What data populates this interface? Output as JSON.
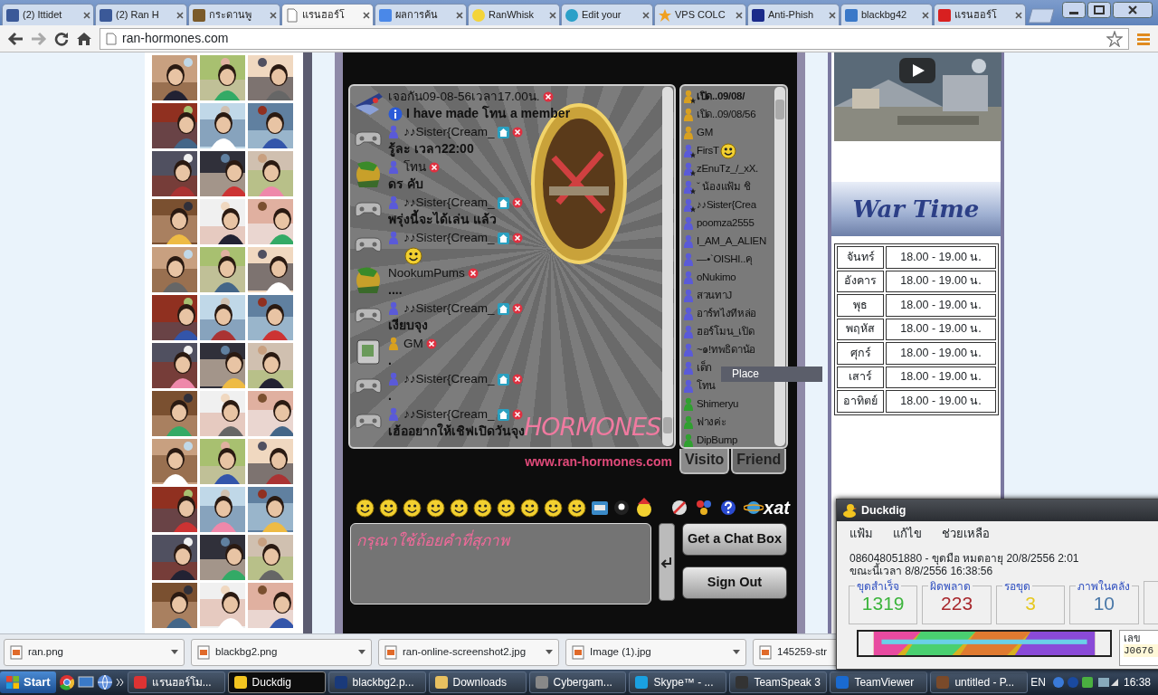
{
  "browser": {
    "tabs": [
      {
        "label": "(2) Ittidet",
        "selected": false
      },
      {
        "label": "(2) Ran H",
        "selected": false
      },
      {
        "label": "กระดานพู",
        "selected": false
      },
      {
        "label": "แรนฮอร์โ",
        "selected": true
      },
      {
        "label": "ผลการค้น",
        "selected": false
      },
      {
        "label": "RanWhisk",
        "selected": false
      },
      {
        "label": "Edit your",
        "selected": false
      },
      {
        "label": "VPS COLC",
        "selected": false
      },
      {
        "label": "Anti-Phish",
        "selected": false
      },
      {
        "label": "blackbg42",
        "selected": false
      },
      {
        "label": "แรนฮอร์โ",
        "selected": false
      }
    ],
    "address": "ran-hormones.com"
  },
  "chat": {
    "messages": [
      {
        "name": "เจอกัน09-08-56เวลา17.00น.",
        "home": false,
        "info": true,
        "kind": "text",
        "text": "I have made โทน a member"
      },
      {
        "color": "#5a5ad8",
        "name": "♪♪Sister{Cream_",
        "home": true,
        "info": false,
        "kind": "text",
        "text": "รู้ละ เวลา22:00"
      },
      {
        "color": "#5a5ad8",
        "name": "โทน",
        "home": false,
        "info": false,
        "kind": "text",
        "text": "ดร คับ"
      },
      {
        "color": "#5a5ad8",
        "name": "♪♪Sister{Cream_",
        "home": true,
        "info": false,
        "kind": "text",
        "text": "พรุ่งนี้จะได้เล่น แล้ว"
      },
      {
        "color": "#5a5ad8",
        "name": "♪♪Sister{Cream_",
        "home": true,
        "info": false,
        "kind": "emoji"
      },
      {
        "name": "NookumPums",
        "home": false,
        "info": false,
        "kind": "text",
        "text": "...."
      },
      {
        "color": "#5a5ad8",
        "name": "♪♪Sister{Cream_",
        "home": true,
        "info": false,
        "kind": "text",
        "text": "เงียบจุง"
      },
      {
        "color": "#d8a020",
        "name": "GM",
        "home": false,
        "info": false,
        "kind": "text",
        "text": "."
      },
      {
        "color": "#5a5ad8",
        "name": "♪♪Sister{Cream_",
        "home": true,
        "info": false,
        "kind": "text",
        "text": "."
      },
      {
        "color": "#5a5ad8",
        "name": "♪♪Sister{Cream_",
        "home": true,
        "info": false,
        "kind": "text",
        "text": "เฮ้ออยากให้เชิฟเปิดวันจุง"
      }
    ],
    "brand": "HORMONES",
    "site_url": "www.ran-hormones.com",
    "users": [
      {
        "name": "เปิด..09/08/",
        "color": "#d8a020",
        "star": true,
        "bold": true,
        "emoji": false
      },
      {
        "name": "เปิด..09/08/56",
        "color": "#d8a020",
        "star": false,
        "bold": false,
        "emoji": false
      },
      {
        "name": "GM",
        "color": "#d8a020",
        "star": false,
        "bold": false,
        "emoji": false
      },
      {
        "name": "FirsT",
        "color": "#5a5ad8",
        "star": true,
        "bold": false,
        "emoji": true
      },
      {
        "name": "zEnuTz_/_xX.",
        "color": "#5a5ad8",
        "star": true,
        "bold": false,
        "emoji": false
      },
      {
        "name": "ˇ น้องแฟ้ม ชิ",
        "color": "#5a5ad8",
        "star": true,
        "bold": false,
        "emoji": false
      },
      {
        "name": "♪♪Sister{Crea",
        "color": "#5a5ad8",
        "star": true,
        "bold": false,
        "emoji": false
      },
      {
        "name": "poomza2555",
        "color": "#5a5ad8",
        "star": false,
        "bold": false,
        "emoji": false
      },
      {
        "name": "I_AM_A_ALIEN",
        "color": "#5a5ad8",
        "star": false,
        "bold": false,
        "emoji": false
      },
      {
        "name": "—•`OISHI..คุ",
        "color": "#5a5ad8",
        "star": false,
        "bold": false,
        "emoji": false
      },
      {
        "name": "oNukimo",
        "color": "#5a5ad8",
        "star": false,
        "bold": false,
        "emoji": false
      },
      {
        "name": "สวนทาJ",
        "color": "#5a5ad8",
        "star": false,
        "bold": false,
        "emoji": false
      },
      {
        "name": "อาร์ทไงทีหล่อ",
        "color": "#5a5ad8",
        "star": false,
        "bold": false,
        "emoji": false
      },
      {
        "name": "ฮอร์โมน_เปิด",
        "color": "#5a5ad8",
        "star": false,
        "bold": false,
        "emoji": false
      },
      {
        "name": "~๑!ทพธิดาน้อ",
        "color": "#5a5ad8",
        "star": false,
        "bold": false,
        "emoji": false
      },
      {
        "name": "เด็ก",
        "color": "#5a5ad8",
        "star": false,
        "bold": false,
        "emoji": false
      },
      {
        "name": "โทน",
        "color": "#5a5ad8",
        "star": false,
        "bold": false,
        "emoji": false
      },
      {
        "name": "Shimeryu",
        "color": "#30a030",
        "star": false,
        "bold": false,
        "emoji": false
      },
      {
        "name": "ฟางค่ะ",
        "color": "#30a030",
        "star": false,
        "bold": false,
        "emoji": false
      },
      {
        "name": "DipBump",
        "color": "#30a030",
        "star": false,
        "bold": false,
        "emoji": false
      }
    ],
    "tooltip": "Place",
    "list_tabs": [
      {
        "label": "Visito",
        "selected": true
      },
      {
        "label": "Friend",
        "selected": false
      }
    ],
    "xat_logo": "xat",
    "input": {
      "placeholder": "กรุณาใช้ถ้อยคำที่สุภาพ"
    },
    "buttons": [
      "Get a Chat Box",
      "Sign Out"
    ]
  },
  "war_time": {
    "title": "War Time",
    "rows": [
      {
        "day": "จันทร์",
        "time": "18.00 - 19.00 น."
      },
      {
        "day": "อังคาร",
        "time": "18.00 - 19.00 น."
      },
      {
        "day": "พุธ",
        "time": "18.00 - 19.00 น."
      },
      {
        "day": "พฤหัส",
        "time": "18.00 - 19.00 น."
      },
      {
        "day": "ศุกร์",
        "time": "18.00 - 19.00 น."
      },
      {
        "day": "เสาร์",
        "time": "18.00 - 19.00 น."
      },
      {
        "day": "อาทิตย์",
        "time": "18.00 - 19.00 น."
      }
    ]
  },
  "duckdig": {
    "title": "Duckdig",
    "menu": [
      "แฟ้ม",
      "แก้ไข",
      "ช่วยเหลือ"
    ],
    "lines": [
      "086048051880 - ขุดมือ หมดอายุ 20/8/2556 2:01",
      "ขณะนี้เวลา 8/8/2556 16:38:56"
    ],
    "stats": [
      {
        "label": "ขุดสำเร็จ",
        "value": "1319",
        "color": "#3cb43c"
      },
      {
        "label": "ผิดพลาด",
        "value": "223",
        "color": "#a8282d"
      },
      {
        "label": "รอขุด",
        "value": "3",
        "color": "#e6c820"
      },
      {
        "label": "ภาพในคลัง",
        "value": "10",
        "color": "#4a78a8"
      }
    ],
    "code_label": "เลข",
    "code": "J0676"
  },
  "downloads": [
    "ran.png",
    "blackbg2.png",
    "ran-online-screenshot2.jpg",
    "Image (1).jpg",
    "145259-str"
  ],
  "taskbar": {
    "start": "Start",
    "items": [
      {
        "label": "แรนฮอร์โม...",
        "selected": false
      },
      {
        "label": "Duckdig",
        "selected": true
      },
      {
        "label": "blackbg2.p...",
        "selected": false
      },
      {
        "label": "Downloads",
        "selected": false
      },
      {
        "label": "Cybergam...",
        "selected": false
      },
      {
        "label": "Skype™ - ...",
        "selected": false
      },
      {
        "label": "TeamSpeak 3",
        "selected": false
      },
      {
        "label": "TeamViewer",
        "selected": false
      },
      {
        "label": "untitled - P...",
        "selected": false
      }
    ],
    "language": "EN",
    "clock": "16:38"
  }
}
